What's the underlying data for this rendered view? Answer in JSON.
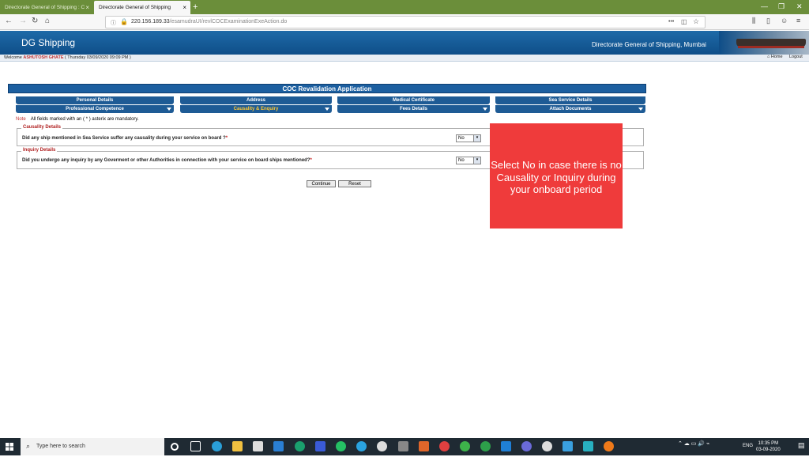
{
  "browser": {
    "tabs": [
      {
        "title": "Directorate General of Shipping : C"
      },
      {
        "title": "Directorate General of Shipping"
      }
    ],
    "url_host": "220.156.189.33",
    "url_path": "/esamudraUI/revlCOCExaminationExeAction.do",
    "new_tab": "+",
    "menu_dots": "•••"
  },
  "site": {
    "brand": "DG Shipping",
    "title": "Directorate General of Shipping, Mumbai",
    "welcome_prefix": "Welcome",
    "user": "ASHUTOSH GHATE",
    "date": "( Thursday 03/09/2020 09:09 PM )",
    "home": "Home",
    "logout": "Logout"
  },
  "form": {
    "title": "COC Revalidation Application",
    "tabs": [
      {
        "label": "Personal Details"
      },
      {
        "label": "Address"
      },
      {
        "label": "Medical Certificate"
      },
      {
        "label": "Sea Service Details"
      },
      {
        "label": "Professional Competence"
      },
      {
        "label": "Causality & Enquiry"
      },
      {
        "label": "Fees Details"
      },
      {
        "label": "Attach Documents"
      }
    ],
    "note_label": "Note",
    "note_text": "All fields marked with an ( * ) asterix are mandatory.",
    "causality": {
      "legend": "Causality Details",
      "question": "Did any ship mentioned in Sea Service suffer any causality during your service on board ?",
      "star": "*",
      "value": "No"
    },
    "inquiry": {
      "legend": "Inquiry Details",
      "question": "Did you undergo any inquiry by any Goverment or other Authorities in connection with your service on board ships mentioned?",
      "star": "*",
      "value": "No"
    },
    "continue": "Continue",
    "reset": "Reset"
  },
  "callout": {
    "text": "Select No in case there is no Causality or Inquiry during your onboard period",
    "color": "#ef3b3b"
  },
  "taskbar": {
    "search_placeholder": "Type here to search",
    "lang": "ENG",
    "time": "10:35 PM",
    "date": "03-09-2020"
  }
}
